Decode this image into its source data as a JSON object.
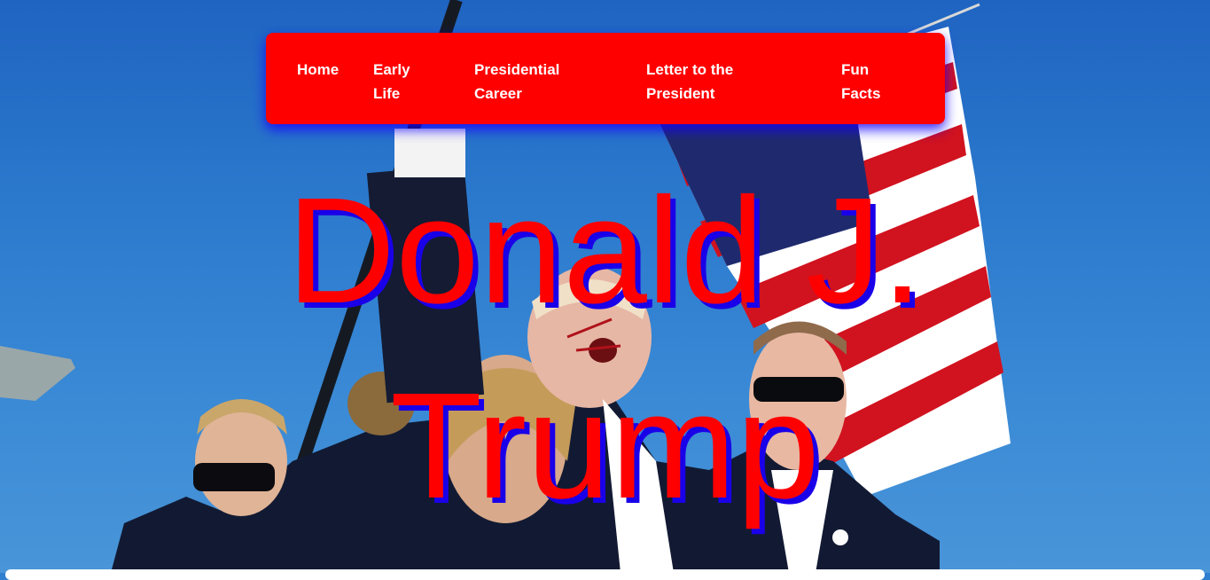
{
  "nav": {
    "items": [
      {
        "line1": "Home",
        "line2": ""
      },
      {
        "line1": "Early",
        "line2": "Life"
      },
      {
        "line1": "Presidential",
        "line2": "Career"
      },
      {
        "line1": "Letter to the",
        "line2": "President"
      },
      {
        "line1": "Fun",
        "line2": "Facts"
      }
    ]
  },
  "hero": {
    "title_line1": "Donald J.",
    "title_line2": "Trump",
    "title_color": "#ff0000",
    "title_shadow_color": "#1a00e8",
    "image_description": "Photo of rally scene with raised fist, secret service agents, and American flag against blue sky"
  },
  "colors": {
    "nav_background": "#ff0000",
    "nav_text": "#ffffff",
    "sky": "#2b79cd"
  }
}
